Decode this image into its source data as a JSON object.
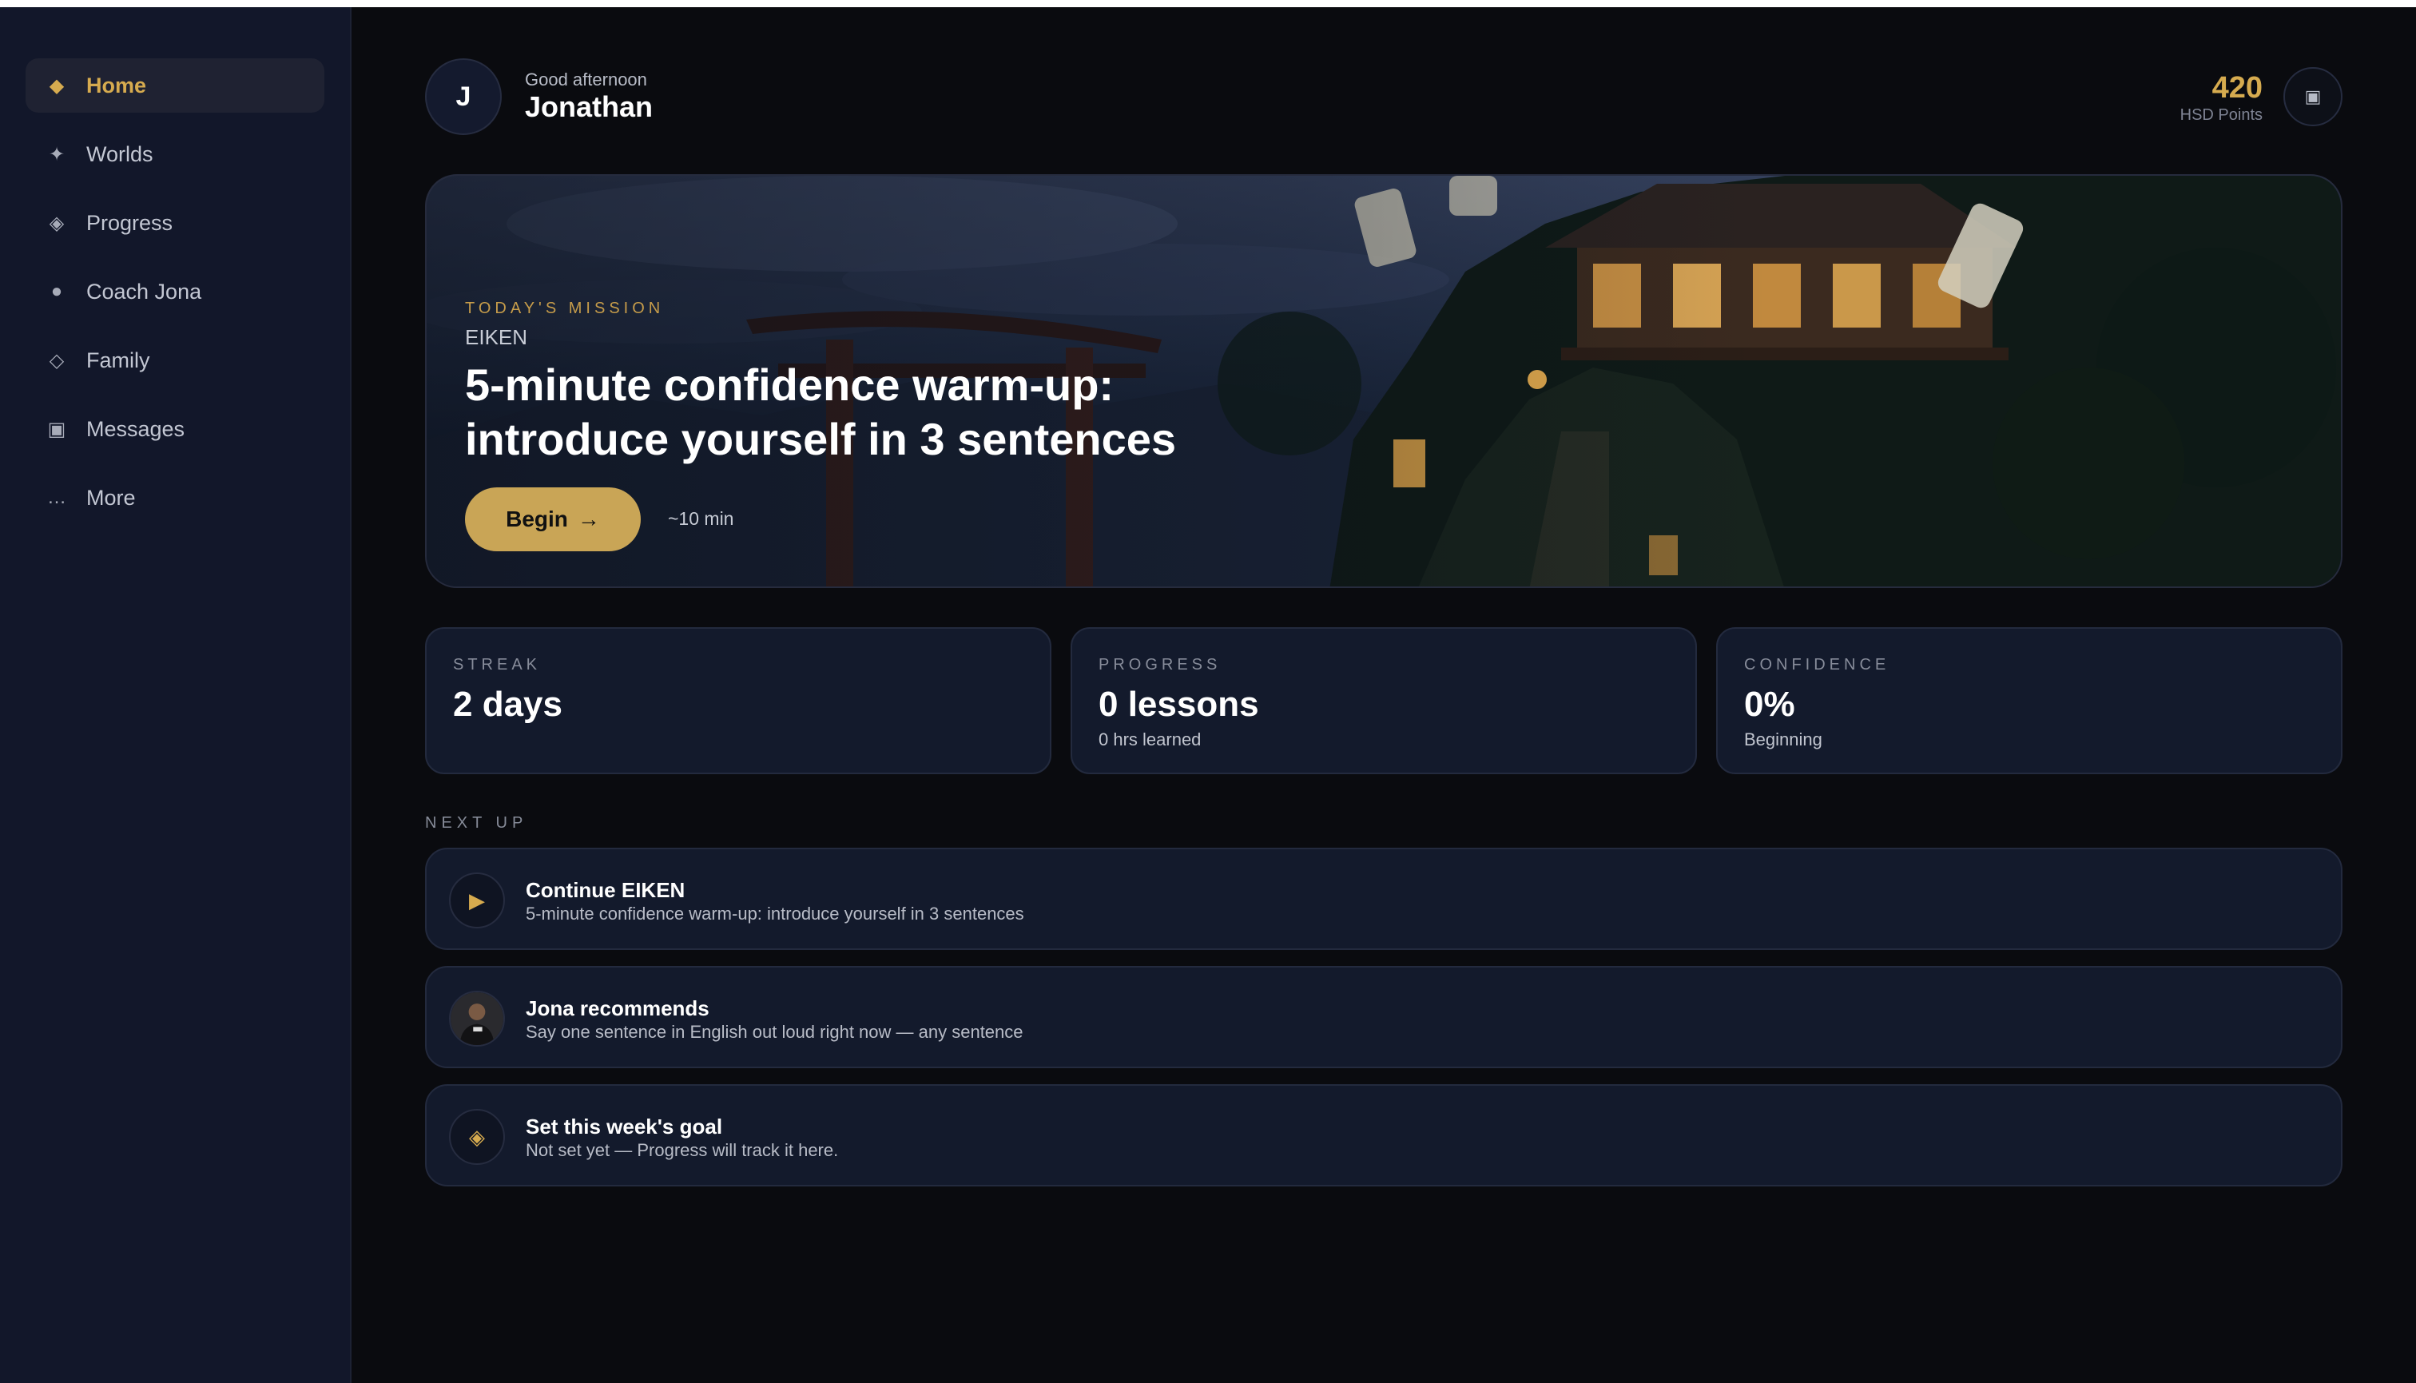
{
  "sidebar": {
    "items": [
      {
        "icon": "diamond-icon",
        "glyph": "◆",
        "label": "Home"
      },
      {
        "icon": "sparkle-icon",
        "glyph": "✦",
        "label": "Worlds"
      },
      {
        "icon": "progress-diamond-icon",
        "glyph": "◈",
        "label": "Progress"
      },
      {
        "icon": "dot-icon",
        "glyph": "●",
        "label": "Coach Jona"
      },
      {
        "icon": "outline-diamond-icon",
        "glyph": "◇",
        "label": "Family"
      },
      {
        "icon": "square-icon",
        "glyph": "▣",
        "label": "Messages"
      },
      {
        "icon": "ellipsis-icon",
        "glyph": "…",
        "label": "More"
      }
    ],
    "active_index": 0
  },
  "header": {
    "avatar_initial": "J",
    "greeting": "Good afternoon",
    "name": "Jonathan",
    "points_value": "420",
    "points_label": "HSD Points",
    "button_icon": "square-icon",
    "button_glyph": "▣"
  },
  "hero": {
    "kicker": "TODAY'S MISSION",
    "tag": "EIKEN",
    "title": "5-minute confidence warm-up: introduce yourself in 3 sentences",
    "begin_label": "Begin",
    "begin_arrow": "→",
    "duration": "~10 min"
  },
  "stats": [
    {
      "label": "STREAK",
      "value": "2 days",
      "sub": ""
    },
    {
      "label": "PROGRESS",
      "value": "0 lessons",
      "sub": "0 hrs learned"
    },
    {
      "label": "CONFIDENCE",
      "value": "0%",
      "sub": "Beginning"
    }
  ],
  "next_up": {
    "title": "NEXT UP",
    "items": [
      {
        "icon": "play-icon",
        "glyph": "▶",
        "title": "Continue EIKEN",
        "sub": "5-minute confidence warm-up: introduce yourself in 3 sentences"
      },
      {
        "icon": "coach-avatar-icon",
        "glyph": "",
        "title": "Jona recommends",
        "sub": "Say one sentence in English out loud right now — any sentence"
      },
      {
        "icon": "goal-diamond-icon",
        "glyph": "◈",
        "title": "Set this week's goal",
        "sub": "Not set yet — Progress will track it here."
      }
    ]
  },
  "colors": {
    "accent": "#d6ab4f",
    "background": "#0a0b0f",
    "sidebar": "#12172a",
    "card": "#131a2c"
  }
}
